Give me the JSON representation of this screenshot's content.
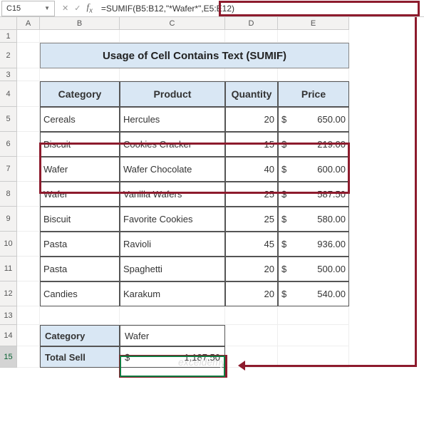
{
  "name_box": "C15",
  "formula": "=SUMIF(B5:B12,\"*Wafer*\",E5:E12)",
  "col_headers": [
    "A",
    "B",
    "C",
    "D",
    "E"
  ],
  "row_headers": [
    "1",
    "2",
    "3",
    "4",
    "5",
    "6",
    "7",
    "8",
    "9",
    "10",
    "11",
    "12",
    "13",
    "14",
    "15"
  ],
  "title": "Usage of Cell Contains Text (SUMIF)",
  "headers": {
    "cat": "Category",
    "prod": "Product",
    "qty": "Quantity",
    "price": "Price"
  },
  "rows": [
    {
      "cat": "Cereals",
      "prod": "Hercules",
      "qty": "20",
      "price": "650.00"
    },
    {
      "cat": "Biscuit",
      "prod": "Cookies Cracker",
      "qty": "15",
      "price": "219.00"
    },
    {
      "cat": "Wafer",
      "prod": "Wafer Chocolate",
      "qty": "40",
      "price": "600.00"
    },
    {
      "cat": "Wafer",
      "prod": "Vanilla Wafers",
      "qty": "25",
      "price": "587.50"
    },
    {
      "cat": "Biscuit",
      "prod": "Favorite Cookies",
      "qty": "25",
      "price": "580.00"
    },
    {
      "cat": "Pasta",
      "prod": "Ravioli",
      "qty": "45",
      "price": "936.00"
    },
    {
      "cat": "Pasta",
      "prod": "Spaghetti",
      "qty": "20",
      "price": "500.00"
    },
    {
      "cat": "Candies",
      "prod": "Karakum",
      "qty": "20",
      "price": "540.00"
    }
  ],
  "summary": {
    "cat_label": "Category",
    "cat_val": "Wafer",
    "total_label": "Total Sell",
    "total_val": "1,187.50",
    "currency": "$"
  },
  "watermark": "exceldemy"
}
